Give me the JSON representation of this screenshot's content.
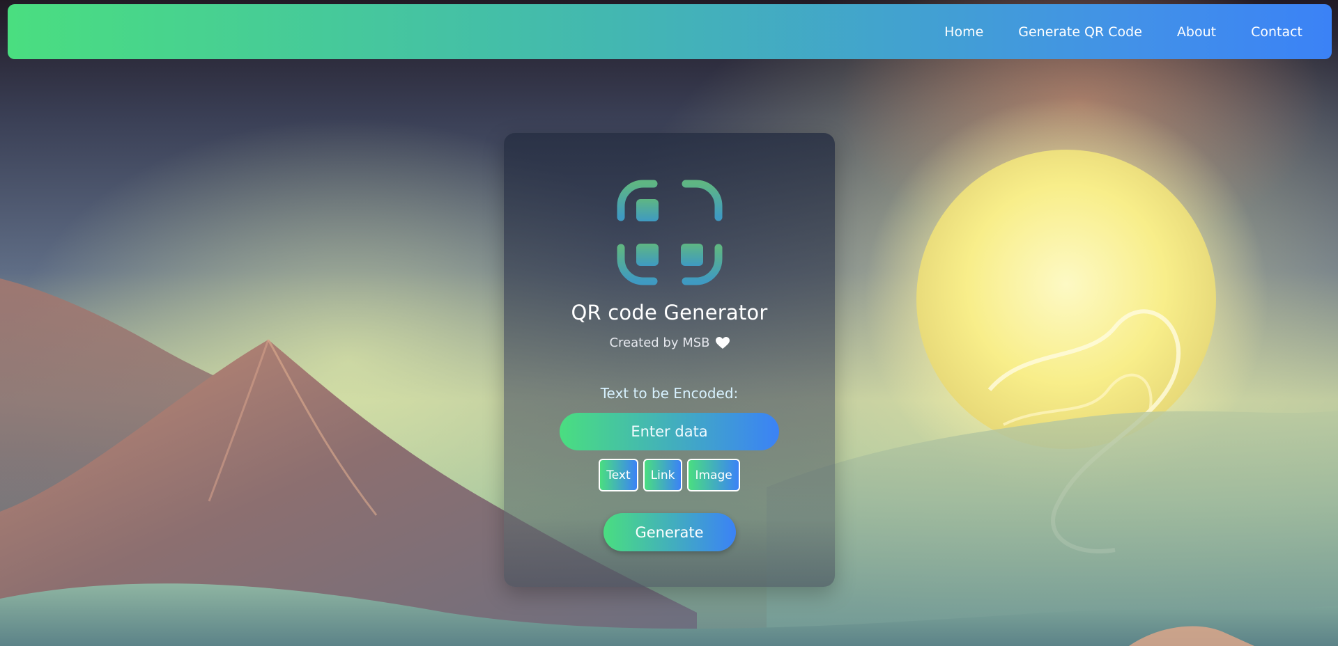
{
  "navbar": {
    "links": [
      "Home",
      "Generate QR Code",
      "About",
      "Contact"
    ]
  },
  "card": {
    "logo_icon": "qr-scan-icon",
    "title": "QR code Generator",
    "subtitle": "Created by MSB",
    "heart_icon": "heart-icon",
    "input_label": "Text to be Encoded:",
    "input_placeholder": "Enter data",
    "input_value": "",
    "type_buttons": [
      "Text",
      "Link",
      "Image"
    ],
    "generate_label": "Generate"
  },
  "colors": {
    "gradient_start": "#4ade80",
    "gradient_end": "#3b82f6"
  }
}
